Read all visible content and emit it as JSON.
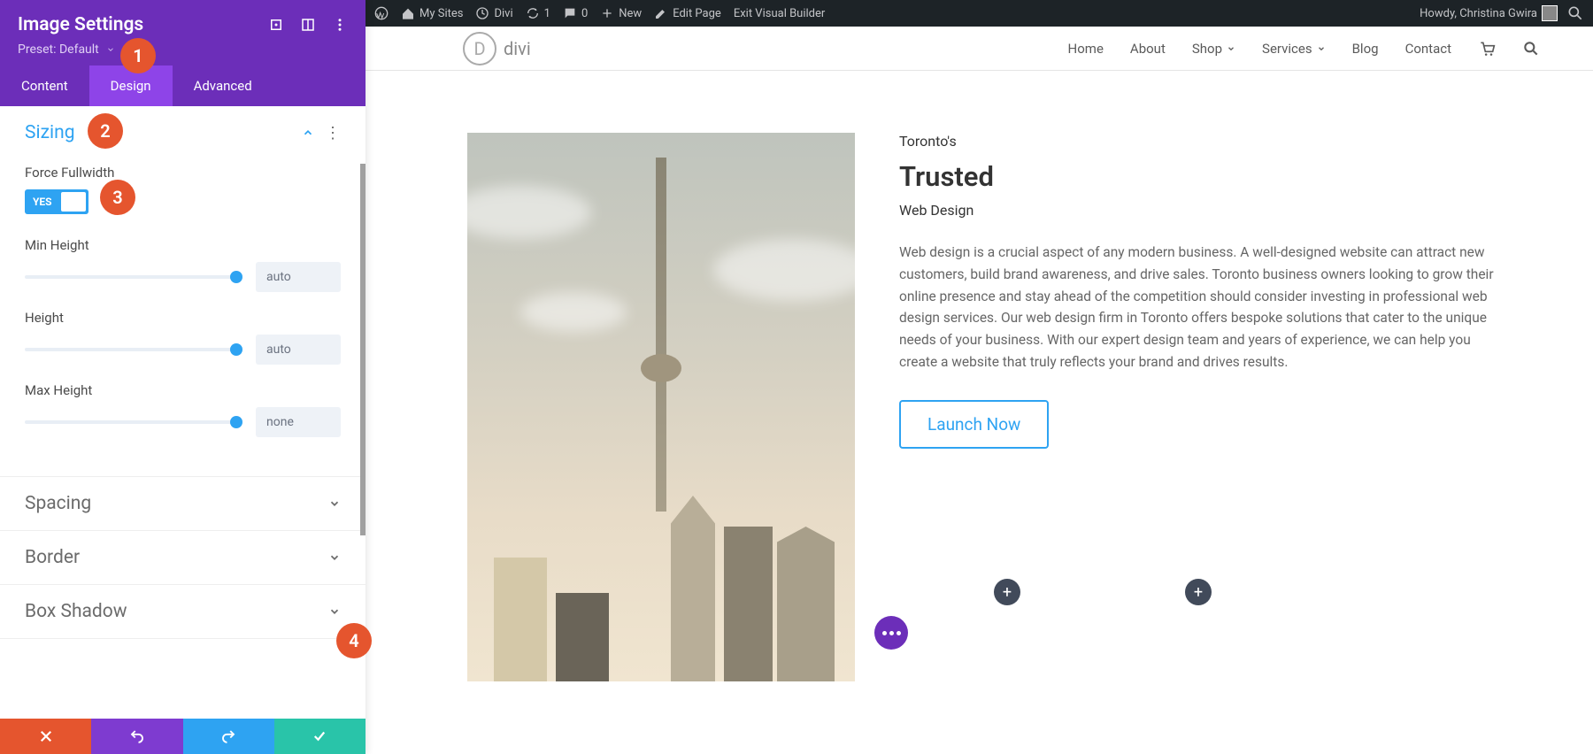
{
  "admin_bar": {
    "my_sites": "My Sites",
    "site_name": "Divi",
    "updates": "1",
    "comments": "0",
    "new": "New",
    "edit_page": "Edit Page",
    "exit_vb": "Exit Visual Builder",
    "howdy": "Howdy, Christina Gwira"
  },
  "panel": {
    "title": "Image Settings",
    "preset_label": "Preset: Default",
    "tabs": {
      "content": "Content",
      "design": "Design",
      "advanced": "Advanced"
    },
    "sizing": {
      "title": "Sizing",
      "force_fullwidth_label": "Force Fullwidth",
      "force_fullwidth_value": "YES",
      "min_height_label": "Min Height",
      "min_height_value": "auto",
      "height_label": "Height",
      "height_value": "auto",
      "max_height_label": "Max Height",
      "max_height_value": "none"
    },
    "spacing": {
      "title": "Spacing"
    },
    "border": {
      "title": "Border"
    },
    "box_shadow": {
      "title": "Box Shadow"
    }
  },
  "markers": {
    "m1": "1",
    "m2": "2",
    "m3": "3",
    "m4": "4"
  },
  "site": {
    "logo_text": "divi",
    "nav": {
      "home": "Home",
      "about": "About",
      "shop": "Shop",
      "services": "Services",
      "blog": "Blog",
      "contact": "Contact"
    },
    "hero": {
      "sub1": "Toronto's",
      "title": "Trusted",
      "sub2": "Web Design",
      "body": "Web design is a crucial aspect of any modern business. A well-designed website can attract new customers, build brand awareness, and drive sales. Toronto business owners looking to grow their online presence and stay ahead of the competition should consider investing in professional web design services. Our web design firm in Toronto offers bespoke solutions that cater to the unique needs of your business. With our expert design team and years of experience, we can help you create a website that truly reflects your brand and drives results.",
      "cta": "Launch Now"
    }
  }
}
